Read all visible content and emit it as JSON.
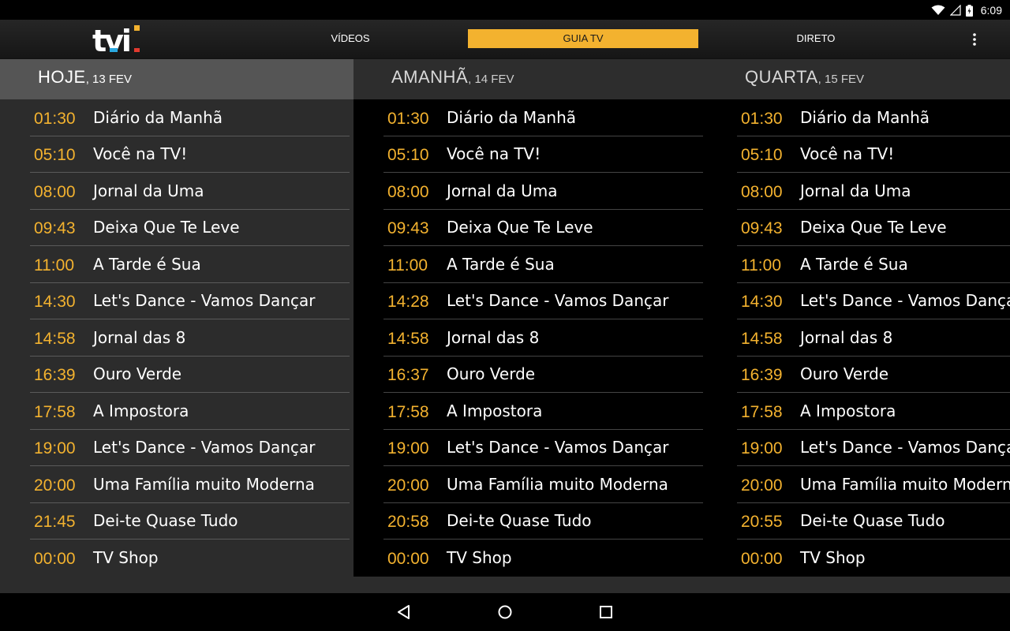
{
  "status": {
    "time": "6:09"
  },
  "app": {
    "logo_text": "tvi",
    "tabs": [
      {
        "label": "VÍDEOS",
        "active": false
      },
      {
        "label": "GUIA TV",
        "active": true
      },
      {
        "label": "DIRETO",
        "active": false
      }
    ],
    "accent_color": "#f3b22f"
  },
  "days": [
    {
      "name": "HOJE",
      "date": ", 13 FEV",
      "programs": [
        {
          "time": "01:30",
          "title": "Diário da Manhã"
        },
        {
          "time": "05:10",
          "title": "Você na TV!"
        },
        {
          "time": "08:00",
          "title": "Jornal da Uma"
        },
        {
          "time": "09:43",
          "title": "Deixa Que Te Leve"
        },
        {
          "time": "11:00",
          "title": "A Tarde é Sua"
        },
        {
          "time": "14:30",
          "title": "Let's Dance - Vamos Dançar"
        },
        {
          "time": "14:58",
          "title": "Jornal das 8"
        },
        {
          "time": "16:39",
          "title": "Ouro Verde"
        },
        {
          "time": "17:58",
          "title": "A Impostora"
        },
        {
          "time": "19:00",
          "title": "Let's Dance - Vamos Dançar"
        },
        {
          "time": "20:00",
          "title": "Uma Família muito Moderna"
        },
        {
          "time": "21:45",
          "title": "Dei-te Quase Tudo"
        },
        {
          "time": "00:00",
          "title": "TV Shop"
        }
      ]
    },
    {
      "name": "AMANHÃ",
      "date": ", 14 FEV",
      "programs": [
        {
          "time": "01:30",
          "title": "Diário da Manhã"
        },
        {
          "time": "05:10",
          "title": "Você na TV!"
        },
        {
          "time": "08:00",
          "title": "Jornal da Uma"
        },
        {
          "time": "09:43",
          "title": "Deixa Que Te Leve"
        },
        {
          "time": "11:00",
          "title": "A Tarde é Sua"
        },
        {
          "time": "14:28",
          "title": "Let's Dance - Vamos Dançar"
        },
        {
          "time": "14:58",
          "title": "Jornal das 8"
        },
        {
          "time": "16:37",
          "title": "Ouro Verde"
        },
        {
          "time": "17:58",
          "title": "A Impostora"
        },
        {
          "time": "19:00",
          "title": "Let's Dance - Vamos Dançar"
        },
        {
          "time": "20:00",
          "title": "Uma Família muito Moderna"
        },
        {
          "time": "20:58",
          "title": "Dei-te Quase Tudo"
        },
        {
          "time": "00:00",
          "title": "TV Shop"
        }
      ]
    },
    {
      "name": "QUARTA",
      "date": ", 15 FEV",
      "programs": [
        {
          "time": "01:30",
          "title": "Diário da Manhã"
        },
        {
          "time": "05:10",
          "title": "Você na TV!"
        },
        {
          "time": "08:00",
          "title": "Jornal da Uma"
        },
        {
          "time": "09:43",
          "title": "Deixa Que Te Leve"
        },
        {
          "time": "11:00",
          "title": "A Tarde é Sua"
        },
        {
          "time": "14:30",
          "title": "Let's Dance - Vamos Dançar"
        },
        {
          "time": "14:58",
          "title": "Jornal das 8"
        },
        {
          "time": "16:39",
          "title": "Ouro Verde"
        },
        {
          "time": "17:58",
          "title": "A Impostora"
        },
        {
          "time": "19:00",
          "title": "Let's Dance - Vamos Dançar"
        },
        {
          "time": "20:00",
          "title": "Uma Família muito Moderna"
        },
        {
          "time": "20:55",
          "title": "Dei-te Quase Tudo"
        },
        {
          "time": "00:00",
          "title": "TV Shop"
        }
      ]
    }
  ]
}
